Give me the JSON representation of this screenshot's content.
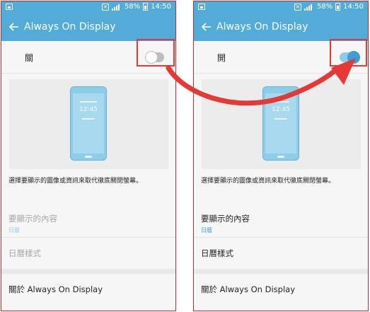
{
  "left_screen": {
    "status": {
      "battery": "58%",
      "time": "14:50"
    },
    "app_title": "Always On Display",
    "toggle": {
      "label": "關",
      "state": "off"
    },
    "preview_clock": "12:45",
    "description": "選擇要顯示的圖像或資訊來取代徹底關閉螢幕。",
    "content_row": {
      "label": "要顯示的內容",
      "value": "日曆"
    },
    "style_row": {
      "label": "日曆樣式"
    },
    "about_row": {
      "label": "關於 Always On Display"
    }
  },
  "right_screen": {
    "status": {
      "battery": "58%",
      "time": "14:50"
    },
    "app_title": "Always On Display",
    "toggle": {
      "label": "開",
      "state": "on"
    },
    "preview_clock": "12:45",
    "description": "選擇要顯示的圖像或資訊來取代徹底關閉螢幕。",
    "content_row": {
      "label": "要顯示的內容",
      "value": "日曆"
    },
    "style_row": {
      "label": "日曆樣式"
    },
    "about_row": {
      "label": "關於 Always On Display"
    }
  },
  "colors": {
    "appbar": "#53abd7",
    "accent": "#3b9ed5",
    "annotation": "#e53935"
  },
  "icons": [
    "gallery-icon",
    "mute-icon",
    "signal-icon",
    "battery-icon",
    "back-arrow-icon"
  ]
}
